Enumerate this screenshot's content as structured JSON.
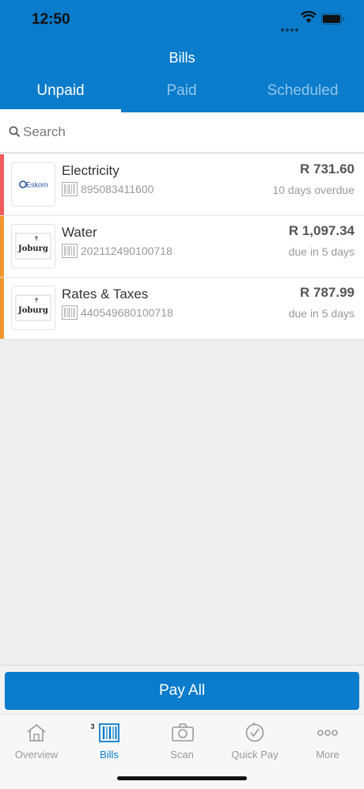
{
  "status_bar": {
    "time": "12:50"
  },
  "header": {
    "title": "Bills",
    "tabs": [
      {
        "label": "Unpaid",
        "active": true
      },
      {
        "label": "Paid",
        "active": false
      },
      {
        "label": "Scheduled",
        "active": false
      }
    ]
  },
  "search": {
    "placeholder": "Search"
  },
  "bills": [
    {
      "name": "Electricity",
      "account": "895083411600",
      "amount": "R 731.60",
      "status": "10 days overdue",
      "logo_text": "Eskom",
      "accent": "#f25c5c"
    },
    {
      "name": "Water",
      "account": "202112490100718",
      "amount": "R 1,097.34",
      "status": "due in 5 days",
      "logo_text": "Joburg",
      "accent": "#f0962a"
    },
    {
      "name": "Rates & Taxes",
      "account": "440549680100718",
      "amount": "R 787.99",
      "status": "due in 5 days",
      "logo_text": "Joburg",
      "accent": "#f0962a"
    }
  ],
  "pay_all_label": "Pay All",
  "nav": {
    "items": [
      {
        "label": "Overview",
        "icon": "home-icon"
      },
      {
        "label": "Bills",
        "icon": "bills-icon",
        "badge": "3",
        "active": true
      },
      {
        "label": "Scan",
        "icon": "camera-icon"
      },
      {
        "label": "Quick Pay",
        "icon": "quick-pay-icon"
      },
      {
        "label": "More",
        "icon": "more-icon"
      }
    ]
  },
  "colors": {
    "primary": "#0a7ccb",
    "overdue": "#f25c5c",
    "due_soon": "#f0962a"
  }
}
